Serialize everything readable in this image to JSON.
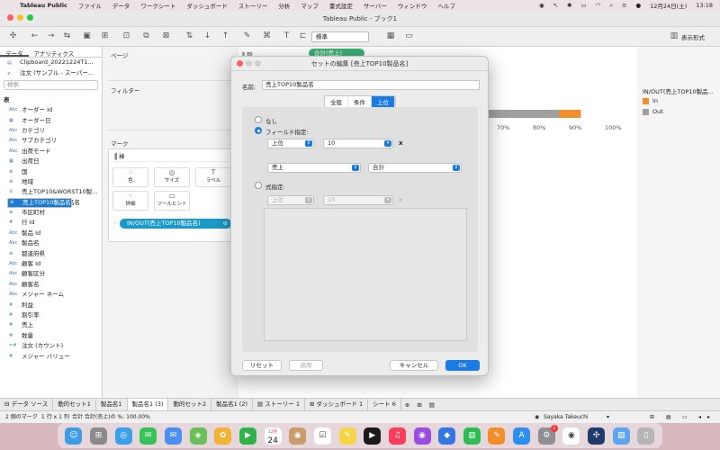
{
  "menubar": {
    "apple": "",
    "app": "Tableau Public",
    "items": [
      "ファイル",
      "データ",
      "ワークシート",
      "ダッシュボード",
      "ストーリー",
      "分析",
      "マップ",
      "書式設定",
      "サーバー",
      "ウィンドウ",
      "ヘルプ"
    ],
    "date": "12月24日(土)",
    "time": "13:18"
  },
  "window": {
    "title": "Tableau Public - ブック1",
    "toolbar": {
      "fit_select": "標準",
      "show_me": "表示形式"
    }
  },
  "datapane": {
    "tab_data": "データ",
    "tab_analytics": "アナリティクス",
    "sources": [
      "Clipboard_20221224T1...",
      "注文 (サンプル - スーパー..."
    ],
    "search_placeholder": "検索",
    "section": "表",
    "dimensions": [
      {
        "icon": "Abc",
        "label": "オーダー Id"
      },
      {
        "icon": "▦",
        "label": "オーダー日"
      },
      {
        "icon": "Abc",
        "label": "カテゴリ"
      },
      {
        "icon": "Abc",
        "label": "サブカテゴリ"
      },
      {
        "icon": "Abc",
        "label": "出荷モード"
      },
      {
        "icon": "▦",
        "label": "出荷日"
      },
      {
        "icon": "⊕",
        "label": "国"
      },
      {
        "icon": "⊕",
        "label": "地域"
      },
      {
        "icon": "⊘",
        "label": "売上TOP10&WORST10製..."
      },
      {
        "icon": "⊘",
        "label": "売上TOP10製品名"
      },
      {
        "icon": "⊘",
        "label": "売上WORST10製品名"
      },
      {
        "icon": "⊕",
        "label": "市区町村"
      },
      {
        "icon": "#",
        "label": "行 Id"
      },
      {
        "icon": "Abc",
        "label": "製品 Id"
      },
      {
        "icon": "Abc",
        "label": "製品名"
      },
      {
        "icon": "⊕",
        "label": "都道府県"
      },
      {
        "icon": "Abc",
        "label": "顧客 Id"
      },
      {
        "icon": "Abc",
        "label": "顧客区分"
      },
      {
        "icon": "Abc",
        "label": "顧客名"
      },
      {
        "icon": "Abc",
        "label": "メジャー ネーム"
      }
    ],
    "measures": [
      {
        "icon": "#",
        "label": "利益"
      },
      {
        "icon": "#",
        "label": "割引率"
      },
      {
        "icon": "#",
        "label": "売上"
      },
      {
        "icon": "#",
        "label": "数量"
      },
      {
        "icon": "=#",
        "label": "注文 (カウント)"
      },
      {
        "icon": "#",
        "label": "メジャー バリュー"
      }
    ],
    "selected_field": "売上TOP10製品名"
  },
  "shelves": {
    "pages": "ページ",
    "filters": "フィルター",
    "marks": "マーク",
    "mark_type": "棒",
    "buttons": {
      "color": "色",
      "size": "サイズ",
      "label": "ラベル",
      "detail": "詳細",
      "tooltip": "ツールヒント"
    },
    "color_pill": "IN/OUT(売上TOP10製品名)",
    "columns_label": "列",
    "columns_pill": "合計(売上)"
  },
  "view": {
    "axis_ticks": [
      "70%",
      "80%",
      "90%",
      "100%"
    ],
    "bar": {
      "in_pct": 0.91,
      "in_color": "#f28e2b",
      "out_color": "#a0a0a0"
    }
  },
  "legend": {
    "title": "IN/OUT(売上TOP10製品...",
    "items": [
      {
        "label": "In",
        "color": "#f28e2b"
      },
      {
        "label": "Out",
        "color": "#a0a0a0"
      }
    ]
  },
  "dialog": {
    "title": "セットの編集 [売上TOP10製品名]",
    "name_label": "名前:",
    "name_value": "売上TOP10製品名",
    "tabs": [
      "全般",
      "条件",
      "上位"
    ],
    "active_tab": "上位",
    "opt_none": "なし",
    "opt_field": "フィールド指定:",
    "top_select": "上位",
    "top_n": "10",
    "by_field": "売上",
    "agg": "合計",
    "opt_formula": "式指定:",
    "formula_top": "上位",
    "formula_n": "10",
    "times": "x",
    "btn_reset": "リセット",
    "btn_apply": "適用",
    "btn_cancel": "キャンセル",
    "btn_ok": "OK"
  },
  "sheettabs": {
    "datasource": "データ ソース",
    "tabs": [
      "動的セット1",
      "製品名1",
      "製品名1 (3)",
      "動的セット2",
      "製品名1 (2)",
      "ストーリー 1",
      "ダッシュボード 1",
      "シート 6"
    ],
    "active": "製品名1 (3)"
  },
  "status": {
    "marks": "2 個のマーク",
    "rows": "1 行 x 1 列",
    "sum": "合計 合計(売上)の %: 100.00%",
    "user": "Sayaka Takeuchi"
  },
  "dock": {
    "calendar_month": "12月",
    "calendar_day": "24",
    "badge": "1",
    "icons": [
      "finder",
      "launchpad",
      "safari",
      "messages",
      "mail",
      "maps",
      "photos",
      "facetime",
      "calendar",
      "contacts",
      "reminders",
      "notes",
      "tv",
      "music",
      "podcasts",
      "keynote",
      "numbers",
      "pages",
      "app-store",
      "system-settings",
      "chrome",
      "tableau",
      "preview",
      "trash"
    ]
  }
}
